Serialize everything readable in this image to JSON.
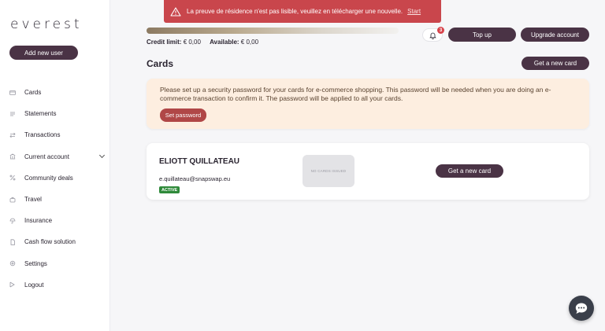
{
  "brand": {
    "logo_text": "everest"
  },
  "sidebar": {
    "add_user_label": "Add new user",
    "items": [
      {
        "label": "Cards",
        "icon": "card-icon"
      },
      {
        "label": "Statements",
        "icon": "statement-icon"
      },
      {
        "label": "Transactions",
        "icon": "transactions-icon"
      },
      {
        "label": "Current account",
        "icon": "account-icon",
        "expandable": true
      },
      {
        "label": "Community deals",
        "icon": "percent-icon"
      },
      {
        "label": "Travel",
        "icon": "travel-icon"
      },
      {
        "label": "Insurance",
        "icon": "insurance-icon"
      },
      {
        "label": "Cash flow solution",
        "icon": "document-icon"
      },
      {
        "label": "Settings",
        "icon": "gear-icon"
      },
      {
        "label": "Logout",
        "icon": "logout-icon"
      }
    ]
  },
  "toast": {
    "message": "La preuve de résidence n'est pas lisible, veuillez en télécharger une nouvelle.",
    "link": "Start",
    "icon": "warning-icon"
  },
  "balance": {
    "credit_limit_label": "Credit limit:",
    "credit_limit_value": "€ 0,00",
    "available_label": "Available:",
    "available_value": "€ 0,00"
  },
  "header": {
    "notifications_count": "3",
    "top_up_label": "Top up",
    "upgrade_label": "Upgrade account"
  },
  "cards_section": {
    "title": "Cards",
    "new_card_label": "Get a new card"
  },
  "notice": {
    "text": "Please set up a security password for your cards for e-commerce shopping. This password will be needed when you are doing an e-commerce transaction to confirm it. The password will be applied to all your cards.",
    "button_label": "Set password"
  },
  "card_holder": {
    "name": "ELIOTT QUILLATEAU",
    "email": "e.quillateau@snapswap.eu",
    "status": "ACTIVE",
    "no_cards_text": "NO CARDS ISSUED",
    "new_card_label": "Get a new card"
  },
  "colors": {
    "accent": "#4a3345",
    "toast": "#c9464c",
    "notice_bg": "#fdeee0",
    "status_active": "#2f8a3a"
  }
}
